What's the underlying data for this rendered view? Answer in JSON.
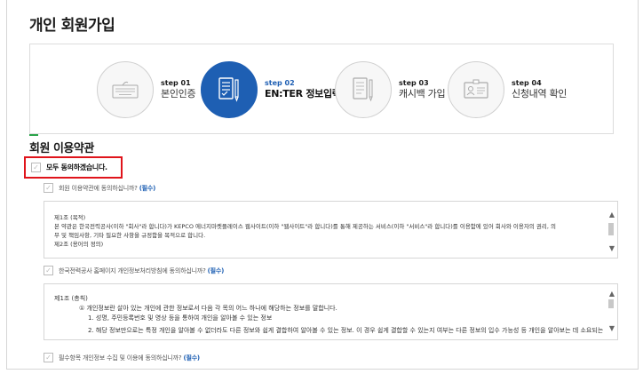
{
  "page": {
    "title": "개인 회원가입"
  },
  "steps": [
    {
      "num": "step 01",
      "name": "본인인증",
      "icon": "keyboard-icon",
      "active": false
    },
    {
      "num": "step 02",
      "name": "EN:TER 정보입력",
      "icon": "form-pen-icon",
      "active": true
    },
    {
      "num": "step 03",
      "name": "캐시백 가입",
      "icon": "document-pen-icon",
      "active": false
    },
    {
      "num": "step 04",
      "name": "신청내역 확인",
      "icon": "id-card-icon",
      "active": false
    }
  ],
  "colors": {
    "accent_blue": "#1e5fb3",
    "highlight_red": "#e0141b",
    "accent_green": "#2aa34a"
  },
  "section": {
    "title": "회원 이용약관"
  },
  "agree_all": {
    "label": "모두 동의하겠습니다."
  },
  "agreements": [
    {
      "label": "회원 이용약관에 동의하십니까?",
      "required": "(필수)",
      "lines": [
        "제1조 (목적)",
        "본 약관은 한국전력공사(이하 \"회사\"라 합니다)가 KEPCO 에너지마켓플레이스 웹사이트(이하 \"웹사이트\"라 합니다)를 통해 제공하는 서비스(이하 \"서비스\"라 합니다)를 이용함에 있어 회사와 이용자의 권리, 의",
        "무 및 책임사항, 기타 필요한 사항을 규정함을 목적으로 합니다.",
        "제2조 (용어의 정의)"
      ]
    },
    {
      "label": "한국전력공사 홈페이지 개인정보처리방침에 동의하십니까?",
      "required": "(필수)",
      "lines": [
        "제1조  (총칙)",
        "① 개인정보란 살아 있는 개인에 관한 정보로서 다음 각 목의 어느 하나에 해당하는 정보를 말합니다.",
        "1. 성명, 주민등록번호 및 영상 등을 통하여 개인을 알아볼 수 있는 정보",
        "2. 해당 정보만으로는 특정 개인을 알아볼 수 없더라도 다른 정보와 쉽게 결합하여 알아볼 수 있는 정보. 이 경우 쉽게 결합할 수 있는지 여부는 다른 정보의 입수 가능성 등 개인을 알아보는 데 소요되는"
      ]
    },
    {
      "label": "필수항목 개인정보 수집 및 이용에 동의하십니까?",
      "required": "(필수)"
    }
  ]
}
